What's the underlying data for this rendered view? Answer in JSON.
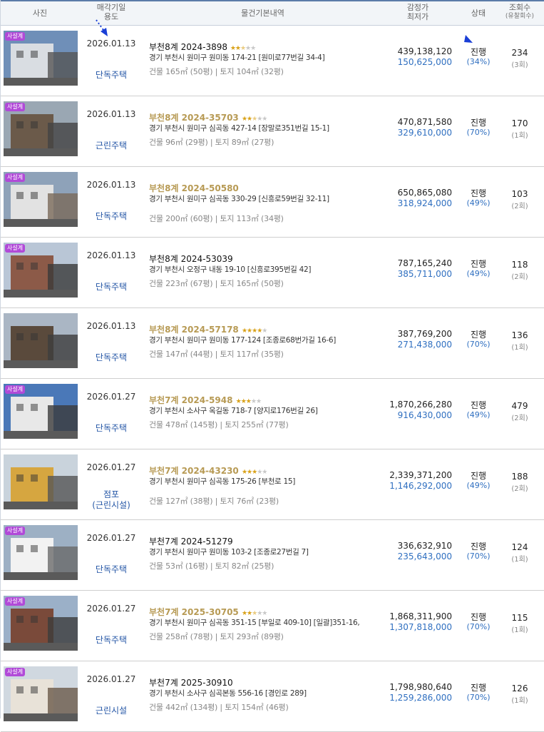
{
  "header": {
    "photo": "사진",
    "date_line1": "매각기일",
    "date_line2": "용도",
    "details": "물건기본내역",
    "price_line1": "감정가",
    "price_line2": "최저가",
    "status": "상태",
    "views_line1": "조회수",
    "views_line2": "(유찰회수)"
  },
  "rows": [
    {
      "badge": "사설계",
      "date": "2026.01.13",
      "use": "단독주택",
      "case": "부천8계 2024-3898",
      "gold": false,
      "stars": 2.5,
      "addr": "경기 부천시 원미구 원미동 174-21 [원미로77번길 34-4]",
      "area": "건물 165㎡ (50평)  |  토지 104㎡ (32평)",
      "appraisal": "439,138,120",
      "min": "150,625,000",
      "status": "진행",
      "ratio": "(34%)",
      "views": "234",
      "fails": "(3회)"
    },
    {
      "badge": "사설계",
      "date": "2026.01.13",
      "use": "근린주택",
      "case": "부천8계 2024-35703",
      "gold": true,
      "stars": 2.5,
      "addr": "경기 부천시 원미구 심곡동 427-14 [장말로351번길 15-1]",
      "area": "건물 96㎡ (29평)  |  토지 89㎡ (27평)",
      "appraisal": "470,871,580",
      "min": "329,610,000",
      "status": "진행",
      "ratio": "(70%)",
      "views": "170",
      "fails": "(1회)"
    },
    {
      "badge": "사설계",
      "date": "2026.01.13",
      "use": "단독주택",
      "case": "부천8계 2024-50580",
      "gold": true,
      "stars": 0,
      "addr": "경기 부천시 원미구 심곡동 330-29 [신흥로59번길 32-11]",
      "area": "건물 200㎡ (60평)  |  토지 113㎡ (34평)",
      "appraisal": "650,865,080",
      "min": "318,924,000",
      "status": "진행",
      "ratio": "(49%)",
      "views": "103",
      "fails": "(2회)"
    },
    {
      "badge": "사설계",
      "date": "2026.01.13",
      "use": "단독주택",
      "case": "부천8계 2024-53039",
      "gold": false,
      "stars": 0,
      "addr": "경기 부천시 오정구 내동 19-10 [신흥로395번길 42]",
      "area": "건물 223㎡ (67평)  |  토지 165㎡ (50평)",
      "appraisal": "787,165,240",
      "min": "385,711,000",
      "status": "진행",
      "ratio": "(49%)",
      "views": "118",
      "fails": "(2회)"
    },
    {
      "badge": "",
      "date": "2026.01.13",
      "use": "단독주택",
      "case": "부천8계 2024-57178",
      "gold": true,
      "stars": 4,
      "addr": "경기 부천시 원미구 원미동 177-124 [조종로68번가길 16-6]",
      "area": "건물 147㎡ (44평)  |  토지 117㎡ (35평)",
      "appraisal": "387,769,200",
      "min": "271,438,000",
      "status": "진행",
      "ratio": "(70%)",
      "views": "136",
      "fails": "(1회)"
    },
    {
      "badge": "사설계",
      "date": "2026.01.27",
      "use": "단독주택",
      "case": "부천7계 2024-5948",
      "gold": true,
      "stars": 3,
      "addr": "경기 부천시 소사구 옥길동 718-7 [양지로176번길 26]",
      "area": "건물 478㎡ (145평)  |  토지 255㎡ (77평)",
      "appraisal": "1,870,266,280",
      "min": "916,430,000",
      "status": "진행",
      "ratio": "(49%)",
      "views": "479",
      "fails": "(2회)"
    },
    {
      "badge": "",
      "date": "2026.01.27",
      "use": "점포",
      "use2": "(근린시설)",
      "case": "부천7계 2024-43230",
      "gold": true,
      "stars": 3,
      "addr": "경기 부천시 원미구 심곡동 175-26 [부천로 15]",
      "area": "건물 127㎡ (38평)  |  토지 76㎡ (23평)",
      "appraisal": "2,339,371,200",
      "min": "1,146,292,000",
      "status": "진행",
      "ratio": "(49%)",
      "views": "188",
      "fails": "(2회)"
    },
    {
      "badge": "사설계",
      "date": "2026.01.27",
      "use": "단독주택",
      "case": "부천7계 2024-51279",
      "gold": false,
      "stars": 0,
      "addr": "경기 부천시 원미구 원미동 103-2 [조종로27번길 7]",
      "area": "건물 53㎡ (16평)  |  토지 82㎡ (25평)",
      "appraisal": "336,632,910",
      "min": "235,643,000",
      "status": "진행",
      "ratio": "(70%)",
      "views": "124",
      "fails": "(1회)"
    },
    {
      "badge": "사설계",
      "date": "2026.01.27",
      "use": "단독주택",
      "case": "부천7계 2025-30705",
      "gold": true,
      "stars": 2.5,
      "addr": "경기 부천시 원미구 심곡동 351-15 [부일로 409-10]  [일괄]351-16,",
      "area": "건물 258㎡ (78평)  |  토지 293㎡ (89평)",
      "appraisal": "1,868,311,900",
      "min": "1,307,818,000",
      "status": "진행",
      "ratio": "(70%)",
      "views": "115",
      "fails": "(1회)"
    },
    {
      "badge": "사설계",
      "date": "2026.01.27",
      "use": "근린시설",
      "case": "부천7계 2025-30910",
      "gold": false,
      "stars": 0,
      "addr": "경기 부천시 소사구 심곡본동 556-16 [경인로 289]",
      "area": "건물 442㎡ (134평)  |  토지 154㎡ (46평)",
      "appraisal": "1,798,980,640",
      "min": "1,259,286,000",
      "status": "진행",
      "ratio": "(70%)",
      "views": "126",
      "fails": "(1회)"
    }
  ],
  "colors": {
    "accent": "#2f6fc0",
    "gold": "#b79a54",
    "badge": "#b14ad8",
    "star": "#d9a219"
  }
}
